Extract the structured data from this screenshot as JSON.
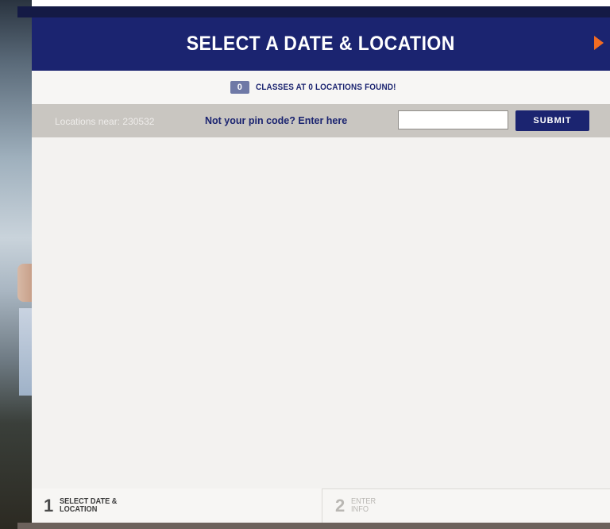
{
  "header": {
    "title": "SELECT A DATE & LOCATION",
    "next_icon": "arrow-right-icon",
    "accent_color": "#f26b22"
  },
  "results": {
    "count": "0",
    "text": "CLASSES AT 0 LOCATIONS FOUND!"
  },
  "search": {
    "locations_near_label": "Locations near: 230532",
    "pin_prompt": "Not your pin code? Enter here",
    "pin_input_value": "",
    "submit_label": "SUBMIT"
  },
  "steps": [
    {
      "number": "1",
      "label": "SELECT DATE & LOCATION"
    },
    {
      "number": "2",
      "label": "ENTER INFO"
    }
  ],
  "colors": {
    "brand_navy": "#1b2470",
    "badge": "#6f79a6",
    "search_bar": "#c9c6c1"
  }
}
